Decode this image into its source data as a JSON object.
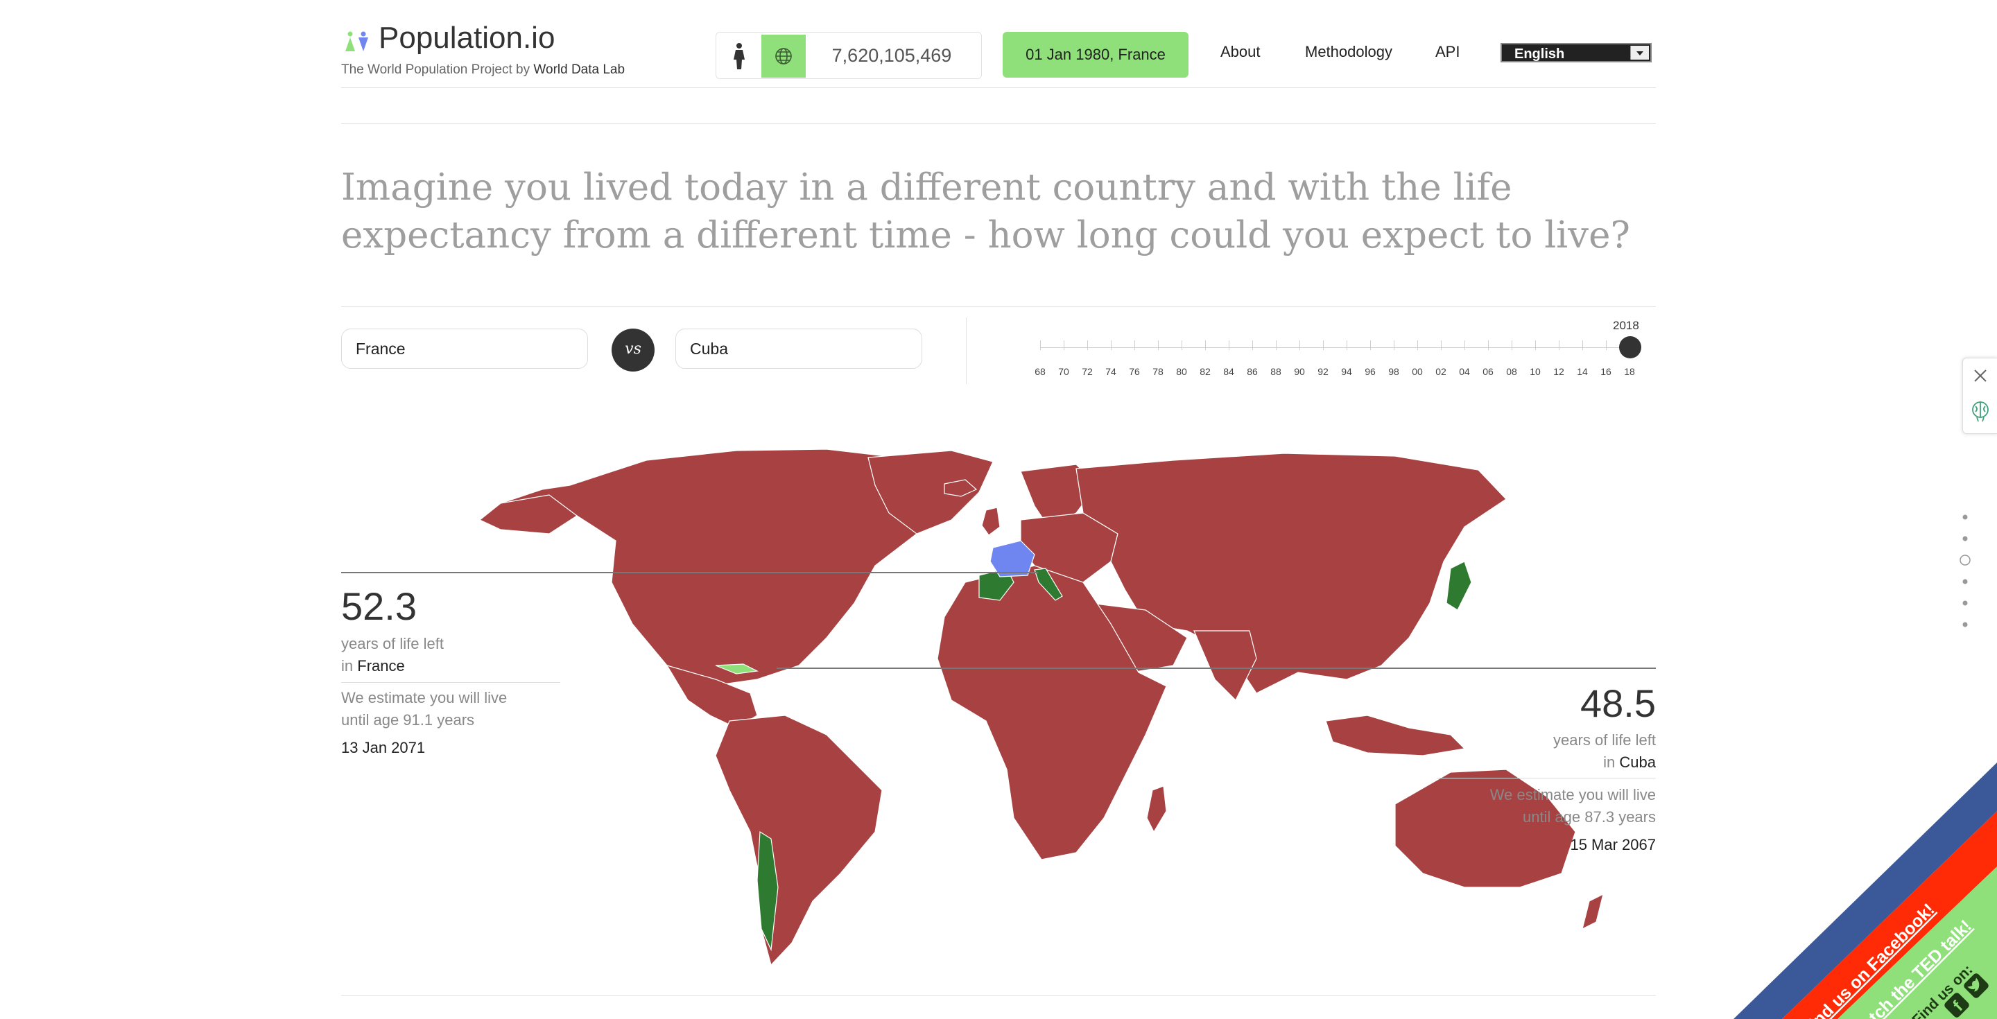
{
  "header": {
    "logo_text": "Population.io",
    "tagline_prefix": "The World Population Project by ",
    "tagline_brand": "World Data Lab",
    "world_population": "7,620,105,469",
    "date_button": "01 Jan 1980, France",
    "nav": [
      "About",
      "Methodology",
      "API"
    ],
    "language": "English"
  },
  "colors": {
    "accent_green": "#8fe07a",
    "map_red": "#a84242",
    "map_green": "#2e7a30",
    "map_blue": "#6f86f0",
    "facebook_blue": "#3b5998",
    "ted_red": "#ff2b06"
  },
  "question": "Imagine you lived today in a different country and with the life expectancy from a different time - how long could you expect to live?",
  "compare": {
    "left_country": "France",
    "vs": "vs",
    "right_country": "Cuba"
  },
  "timeline": {
    "selected_year": "2018",
    "labels": [
      "68",
      "70",
      "72",
      "74",
      "76",
      "78",
      "80",
      "82",
      "84",
      "86",
      "88",
      "90",
      "92",
      "94",
      "96",
      "98",
      "00",
      "02",
      "04",
      "06",
      "08",
      "10",
      "12",
      "14",
      "16",
      "18"
    ]
  },
  "left_result": {
    "years": "52.3",
    "years_label": "years of life left",
    "in_prefix": "in ",
    "country": "France",
    "estimate_line1": "We estimate you will live",
    "estimate_line2": "until age 91.1 years",
    "date": "13 Jan 2071"
  },
  "right_result": {
    "years": "48.5",
    "years_label": "years of life left",
    "in_prefix": "in ",
    "country": "Cuba",
    "estimate_line1": "We estimate you will live",
    "estimate_line2": "until age 87.3 years",
    "date": "15 Mar 2067"
  },
  "side_widget": {
    "icons": [
      "close-icon",
      "brain-icon"
    ],
    "dots": 6,
    "active_dot": 3
  },
  "ribbons": {
    "facebook": "Find us on Facebook!",
    "ted": "Watch the TED talk!",
    "social": "Find us on:"
  }
}
